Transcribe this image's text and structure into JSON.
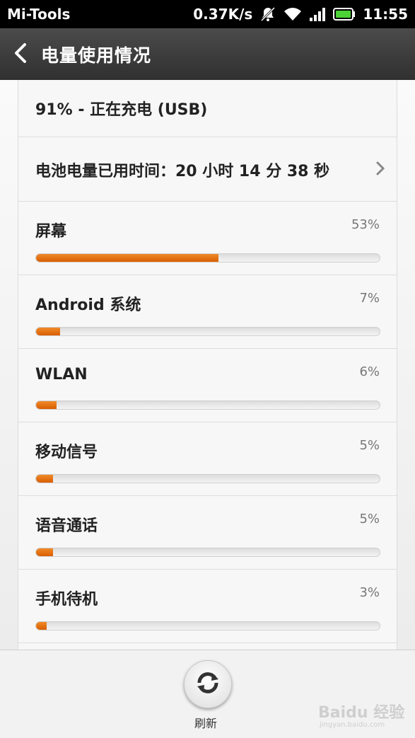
{
  "status_bar": {
    "app_name": "Mi-Tools",
    "speed": "0.37K/s",
    "time": "11:55",
    "icons": [
      "notifications-off-icon",
      "wifi-icon",
      "signal-icon",
      "battery-charging-icon"
    ]
  },
  "title_bar": {
    "title": "电量使用情况",
    "back_icon": "back-arrow-icon"
  },
  "battery": {
    "status": "91% - 正在充电 (USB)",
    "time_used": "电池电量已用时间：20 小时 14 分 38 秒"
  },
  "usage": [
    {
      "name": "屏幕",
      "percent_label": "53%",
      "percent": 53
    },
    {
      "name": "Android 系统",
      "percent_label": "7%",
      "percent": 7
    },
    {
      "name": "WLAN",
      "percent_label": "6%",
      "percent": 6
    },
    {
      "name": "移动信号",
      "percent_label": "5%",
      "percent": 5
    },
    {
      "name": "语音通话",
      "percent_label": "5%",
      "percent": 5
    },
    {
      "name": "手机待机",
      "percent_label": "3%",
      "percent": 3
    }
  ],
  "bottom": {
    "refresh_label": "刷新",
    "watermark": "Baidu 经验",
    "watermark_sub": "jingyan.baidu.com"
  },
  "colors": {
    "accent": "#e8730f",
    "title_bar": "#3a3a3a",
    "battery_green": "#4cd137"
  }
}
